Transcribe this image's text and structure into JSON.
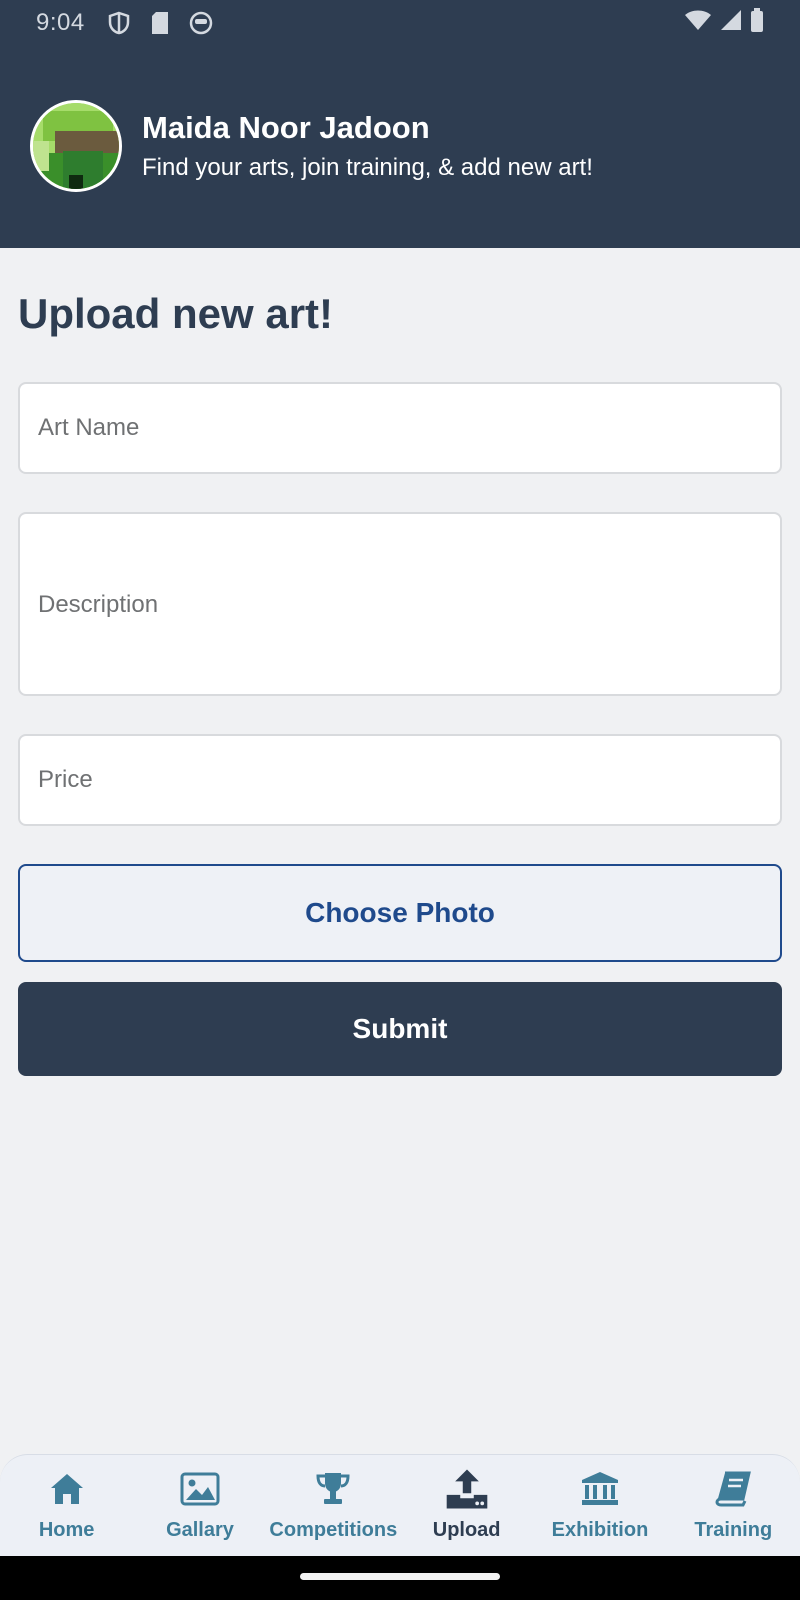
{
  "status_bar": {
    "time": "9:04"
  },
  "profile": {
    "name": "Maida Noor Jadoon",
    "subtitle": "Find your arts, join training, & add new art!"
  },
  "page": {
    "title": "Upload new art!"
  },
  "form": {
    "art_name_placeholder": "Art Name",
    "art_name_value": "",
    "description_placeholder": "Description",
    "description_value": "",
    "price_placeholder": "Price",
    "price_value": "",
    "choose_photo_label": "Choose Photo",
    "submit_label": "Submit"
  },
  "bottom_nav": {
    "items": [
      {
        "label": "Home",
        "icon": "home-icon"
      },
      {
        "label": "Gallary",
        "icon": "image-icon"
      },
      {
        "label": "Competitions",
        "icon": "trophy-icon"
      },
      {
        "label": "Upload",
        "icon": "upload-icon",
        "active": true
      },
      {
        "label": "Exhibition",
        "icon": "museum-icon"
      },
      {
        "label": "Training",
        "icon": "book-icon"
      }
    ]
  },
  "colors": {
    "header_bg": "#2e3d51",
    "accent_blue": "#1f4a8c",
    "nav_inactive": "#3f7d99",
    "page_bg": "#f0f1f3"
  }
}
